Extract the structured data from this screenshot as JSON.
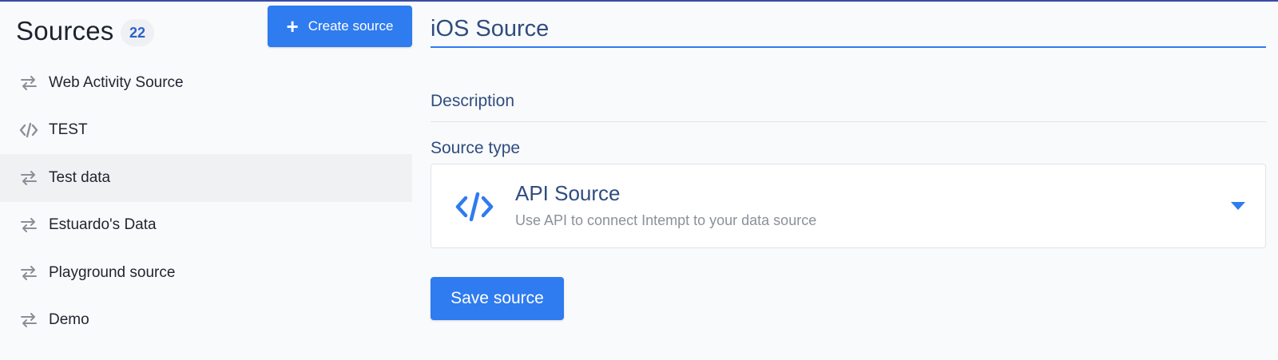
{
  "sidebar": {
    "title": "Sources",
    "count": "22",
    "create_button_label": "Create source",
    "items": [
      {
        "label": "Web Activity Source",
        "icon": "arrows-swap-icon",
        "active": false
      },
      {
        "label": "TEST",
        "icon": "code-icon",
        "active": false
      },
      {
        "label": "Test data",
        "icon": "arrows-swap-icon",
        "active": true
      },
      {
        "label": "Estuardo's Data",
        "icon": "arrows-swap-icon",
        "active": false
      },
      {
        "label": "Playground source",
        "icon": "arrows-swap-icon",
        "active": false
      },
      {
        "label": "Demo",
        "icon": "arrows-swap-icon",
        "active": false
      }
    ]
  },
  "editor": {
    "name_value": "iOS Source",
    "description_label": "Description",
    "source_type_label": "Source type",
    "source_type": {
      "name": "API Source",
      "description": "Use API to connect Intempt to your data source",
      "icon": "code-icon"
    },
    "save_button_label": "Save source"
  },
  "colors": {
    "accent": "#2f7bf0",
    "heading": "#2f4d7f",
    "badge_text": "#2d62c8",
    "muted": "#8b909a",
    "active_row": "#f0f1f3"
  }
}
